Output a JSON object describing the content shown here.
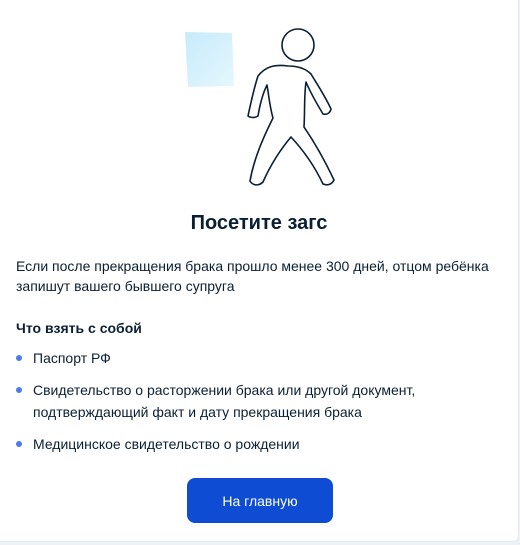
{
  "illustration": {
    "icon": "walking-person-icon",
    "accent_color": "#cfeefc"
  },
  "title": "Посетите загс",
  "description": "Если после прекращения брака прошло менее 300 дней, отцом ребёнка запишут вашего бывшего супруга",
  "checklist": {
    "heading": "Что взять с собой",
    "items": [
      {
        "text": "Паспорт РФ"
      },
      {
        "text": "Свидетельство о расторжении брака или другой документ, подтверждающий факт и дату прекращения брака"
      },
      {
        "text": "Медицинское свидетельство о рождении"
      }
    ]
  },
  "home_button": {
    "label": "На главную",
    "color": "#0d4cd3"
  }
}
